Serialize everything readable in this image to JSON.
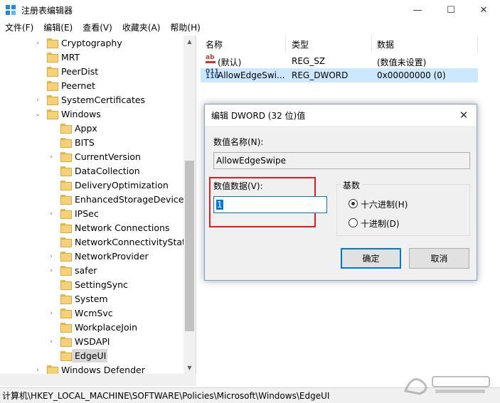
{
  "window": {
    "title": "注册表编辑器",
    "controls": {
      "minimize": "—",
      "maximize": "☐",
      "close": "✕"
    }
  },
  "menu": [
    "文件(F)",
    "编辑(E)",
    "查看(V)",
    "收藏夹(A)",
    "帮助(H)"
  ],
  "tree": {
    "items": [
      {
        "label": "Cryptography",
        "expander": "›"
      },
      {
        "label": "MRT",
        "expander": ""
      },
      {
        "label": "PeerDist",
        "expander": ""
      },
      {
        "label": "Peernet",
        "expander": ""
      },
      {
        "label": "SystemCertificates",
        "expander": "›"
      },
      {
        "label": "Windows",
        "expander": "⌄"
      },
      {
        "label": "Appx",
        "expander": ""
      },
      {
        "label": "BITS",
        "expander": ""
      },
      {
        "label": "CurrentVersion",
        "expander": "›"
      },
      {
        "label": "DataCollection",
        "expander": ""
      },
      {
        "label": "DeliveryOptimization",
        "expander": ""
      },
      {
        "label": "EnhancedStorageDevices",
        "expander": ""
      },
      {
        "label": "IPSec",
        "expander": "›"
      },
      {
        "label": "Network Connections",
        "expander": ""
      },
      {
        "label": "NetworkConnectivityStatus",
        "expander": ""
      },
      {
        "label": "NetworkProvider",
        "expander": "›"
      },
      {
        "label": "safer",
        "expander": "›"
      },
      {
        "label": "SettingSync",
        "expander": ""
      },
      {
        "label": "System",
        "expander": ""
      },
      {
        "label": "WcmSvc",
        "expander": "›"
      },
      {
        "label": "WorkplaceJoin",
        "expander": ""
      },
      {
        "label": "WSDAPI",
        "expander": "›"
      },
      {
        "label": "EdgeUI",
        "expander": ""
      },
      {
        "label": "Windows Defender",
        "expander": "›"
      }
    ],
    "selected": "EdgeUI"
  },
  "values": {
    "columns": [
      "名称",
      "类型",
      "数据"
    ],
    "rows": [
      {
        "icon": "string-value-icon",
        "name": "(默认)",
        "type": "REG_SZ",
        "data": "(数值未设置)"
      },
      {
        "icon": "dword-value-icon",
        "name": "AllowEdgeSwi...",
        "type": "REG_DWORD",
        "data": "0x00000000 (0)"
      }
    ]
  },
  "status": {
    "path": "计算机\\HKEY_LOCAL_MACHINE\\SOFTWARE\\Policies\\Microsoft\\Windows\\EdgeUI"
  },
  "dialog": {
    "title": "编辑 DWORD (32 位)值",
    "name_label": "数值名称(N):",
    "name_value": "AllowEdgeSwipe",
    "data_label": "数值数据(V):",
    "data_value": "1",
    "base_label": "基数",
    "base_hex": "十六进制(H)",
    "base_dec": "十进制(D)",
    "base_selected": "hex",
    "ok": "确定",
    "cancel": "取消"
  },
  "colors": {
    "highlight_box": "#e02020",
    "selection": "#cce8ff",
    "accent": "#0078d7"
  }
}
